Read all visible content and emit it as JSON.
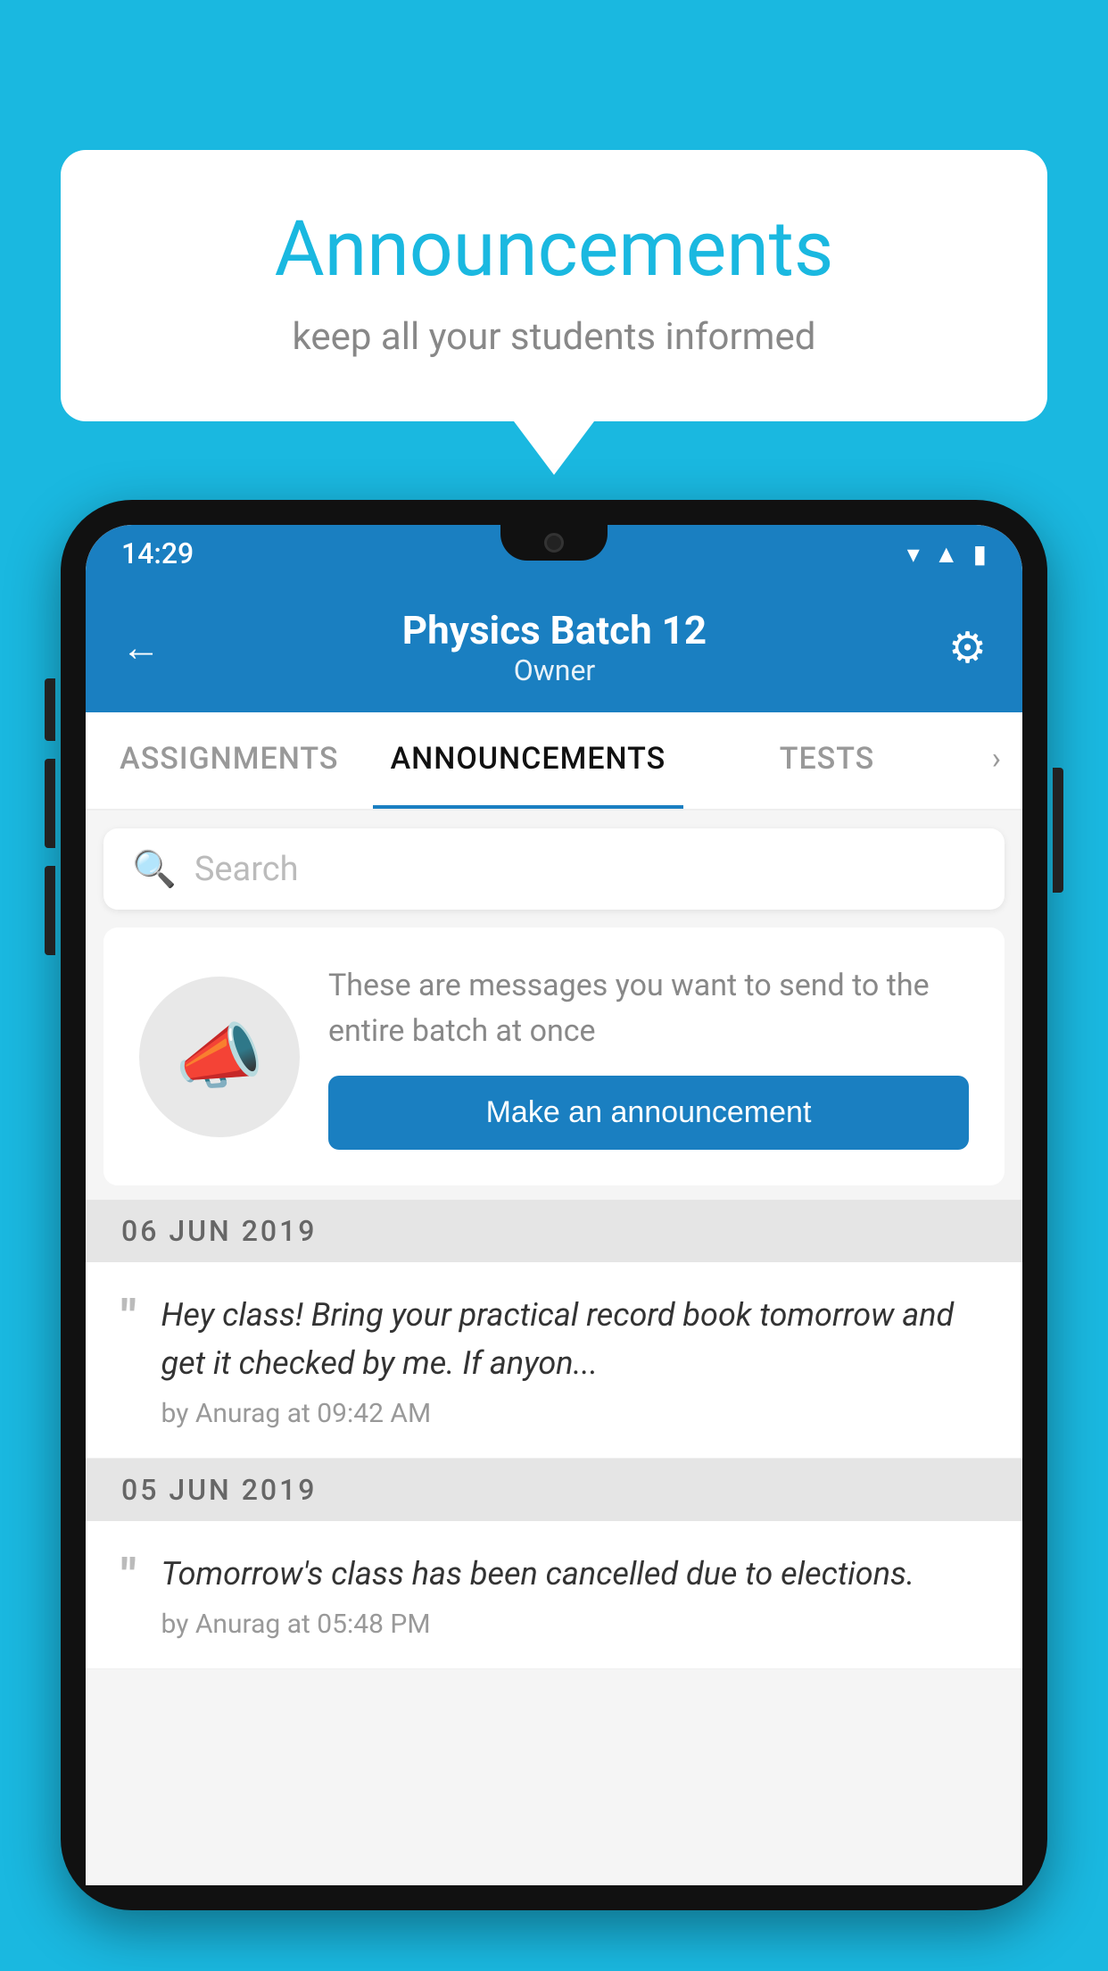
{
  "background_color": "#1ab8e0",
  "speech_bubble": {
    "title": "Announcements",
    "subtitle": "keep all your students informed"
  },
  "status_bar": {
    "time": "14:29",
    "icons": [
      "wifi",
      "signal",
      "battery"
    ]
  },
  "header": {
    "title": "Physics Batch 12",
    "subtitle": "Owner",
    "back_label": "←",
    "gear_label": "⚙"
  },
  "tabs": [
    {
      "label": "ASSIGNMENTS",
      "active": false
    },
    {
      "label": "ANNOUNCEMENTS",
      "active": true
    },
    {
      "label": "TESTS",
      "active": false
    }
  ],
  "search": {
    "placeholder": "Search"
  },
  "announcement_prompt": {
    "description": "These are messages you want to send to the entire batch at once",
    "button_label": "Make an announcement"
  },
  "announcements": [
    {
      "date": "06  JUN  2019",
      "text": "Hey class! Bring your practical record book tomorrow and get it checked by me. If anyon...",
      "meta": "by Anurag at 09:42 AM"
    },
    {
      "date": "05  JUN  2019",
      "text": "Tomorrow's class has been cancelled due to elections.",
      "meta": "by Anurag at 05:48 PM"
    }
  ]
}
